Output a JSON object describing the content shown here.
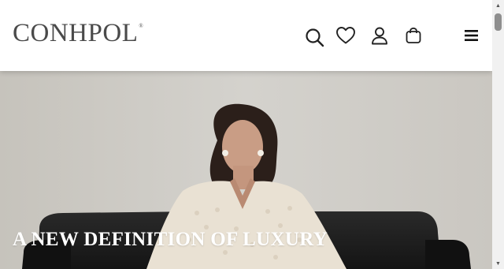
{
  "brand": {
    "name": "CONHPOL",
    "trademark": "®"
  },
  "header": {
    "icons": [
      "search-icon",
      "heart-icon",
      "user-icon",
      "shopping-bag-icon",
      "menu-icon"
    ]
  },
  "hero": {
    "title": "A NEW DEFINITION OF LUXURY",
    "subtitle": ""
  },
  "colors": {
    "logo": "#4a4a4a",
    "header_bg": "#ffffff",
    "icon": "#222222",
    "hero_text": "#ffffff"
  }
}
